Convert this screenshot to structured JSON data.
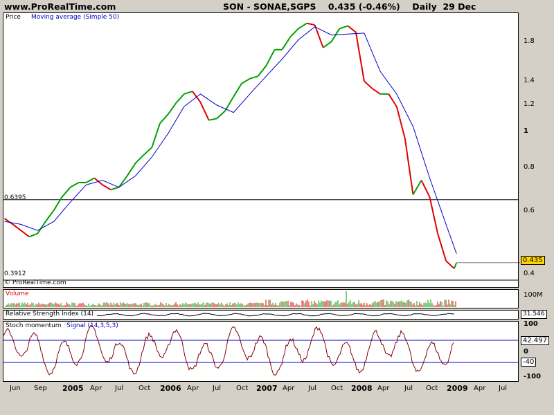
{
  "header": {
    "site": "www.ProRealTime.com",
    "title": "SON - SONAE,SGPS",
    "change": "0.435 (-0.46%)",
    "period": "Daily",
    "date": "29 Dec"
  },
  "price_panel": {
    "price_label": "Price",
    "ma_label": "Moving average (Simple 50)",
    "hline_high": "0.6395",
    "hline_low": "0.3912",
    "credit": "© ProRealTime.com",
    "last_value": "0.435",
    "yticks": [
      "1.8",
      "1.4",
      "1.2",
      "1",
      "0.8",
      "0.6",
      "0.4"
    ]
  },
  "volume_panel": {
    "label": "Volume",
    "ytick": "100M"
  },
  "rsi_panel": {
    "label": "Relative Strength Index (14)",
    "value": "31.546"
  },
  "stoch_panel": {
    "label": "Stoch momentum",
    "signal": "Signal (14,3,5,3)",
    "yticks": [
      "100",
      "0",
      "-100"
    ],
    "value": "42.497",
    "level": "-40"
  },
  "xaxis": {
    "labels": [
      {
        "t": "Jun",
        "bold": false
      },
      {
        "t": "Sep",
        "bold": false
      },
      {
        "t": "2005",
        "bold": true
      },
      {
        "t": "Apr",
        "bold": false
      },
      {
        "t": "Jul",
        "bold": false
      },
      {
        "t": "Oct",
        "bold": false
      },
      {
        "t": "2006",
        "bold": true
      },
      {
        "t": "Apr",
        "bold": false
      },
      {
        "t": "Jul",
        "bold": false
      },
      {
        "t": "Oct",
        "bold": false
      },
      {
        "t": "2007",
        "bold": true
      },
      {
        "t": "Apr",
        "bold": false
      },
      {
        "t": "Jul",
        "bold": false
      },
      {
        "t": "Oct",
        "bold": false
      },
      {
        "t": "2008",
        "bold": true
      },
      {
        "t": "Apr",
        "bold": false
      },
      {
        "t": "Jul",
        "bold": false
      },
      {
        "t": "Oct",
        "bold": false
      },
      {
        "t": "2009",
        "bold": true
      },
      {
        "t": "Apr",
        "bold": false
      },
      {
        "t": "Jul",
        "bold": false
      }
    ]
  },
  "colors": {
    "up": "#00a000",
    "down": "#e00000",
    "ma": "#0000c8",
    "panel_bg": "#ffffff",
    "chrome": "#d4d0c8"
  },
  "chart_data": {
    "type": "line",
    "scale": "log",
    "ylim": [
      0.375,
      2.0
    ],
    "x_range": [
      "2004-05-16",
      "2009-08-15"
    ],
    "series": [
      {
        "name": "Price",
        "points": [
          [
            "2004-05-20",
            0.57
          ],
          [
            "2004-06-20",
            0.55
          ],
          [
            "2004-07-20",
            0.53
          ],
          [
            "2004-08-20",
            0.51
          ],
          [
            "2004-09-20",
            0.52
          ],
          [
            "2004-10-20",
            0.56
          ],
          [
            "2004-11-20",
            0.6
          ],
          [
            "2004-12-20",
            0.65
          ],
          [
            "2005-01-20",
            0.69
          ],
          [
            "2005-02-20",
            0.71
          ],
          [
            "2005-03-20",
            0.71
          ],
          [
            "2005-04-20",
            0.73
          ],
          [
            "2005-05-20",
            0.7
          ],
          [
            "2005-06-20",
            0.68
          ],
          [
            "2005-07-20",
            0.69
          ],
          [
            "2005-08-20",
            0.74
          ],
          [
            "2005-09-20",
            0.8
          ],
          [
            "2005-10-20",
            0.84
          ],
          [
            "2005-11-20",
            0.88
          ],
          [
            "2005-12-20",
            1.02
          ],
          [
            "2006-01-20",
            1.08
          ],
          [
            "2006-02-20",
            1.16
          ],
          [
            "2006-03-20",
            1.22
          ],
          [
            "2006-04-20",
            1.24
          ],
          [
            "2006-05-20",
            1.16
          ],
          [
            "2006-06-20",
            1.04
          ],
          [
            "2006-07-20",
            1.05
          ],
          [
            "2006-08-20",
            1.1
          ],
          [
            "2006-09-20",
            1.2
          ],
          [
            "2006-10-20",
            1.3
          ],
          [
            "2006-11-20",
            1.34
          ],
          [
            "2006-12-20",
            1.36
          ],
          [
            "2007-01-20",
            1.45
          ],
          [
            "2007-02-20",
            1.6
          ],
          [
            "2007-03-20",
            1.6
          ],
          [
            "2007-04-20",
            1.73
          ],
          [
            "2007-05-20",
            1.82
          ],
          [
            "2007-06-20",
            1.88
          ],
          [
            "2007-07-20",
            1.86
          ],
          [
            "2007-08-20",
            1.62
          ],
          [
            "2007-09-20",
            1.68
          ],
          [
            "2007-10-20",
            1.82
          ],
          [
            "2007-11-20",
            1.85
          ],
          [
            "2007-12-20",
            1.78
          ],
          [
            "2008-01-20",
            1.32
          ],
          [
            "2008-02-20",
            1.26
          ],
          [
            "2008-03-20",
            1.22
          ],
          [
            "2008-04-20",
            1.22
          ],
          [
            "2008-05-20",
            1.13
          ],
          [
            "2008-06-20",
            0.93
          ],
          [
            "2008-07-20",
            0.66
          ],
          [
            "2008-08-20",
            0.72
          ],
          [
            "2008-09-20",
            0.65
          ],
          [
            "2008-10-20",
            0.52
          ],
          [
            "2008-11-20",
            0.44
          ],
          [
            "2008-12-20",
            0.42
          ],
          [
            "2008-12-29",
            0.435
          ]
        ]
      },
      {
        "name": "Moving average (Simple 50)",
        "points": [
          [
            "2004-05-20",
            0.56
          ],
          [
            "2004-07-20",
            0.55
          ],
          [
            "2004-09-20",
            0.53
          ],
          [
            "2004-11-20",
            0.56
          ],
          [
            "2005-01-20",
            0.63
          ],
          [
            "2005-03-20",
            0.7
          ],
          [
            "2005-05-20",
            0.72
          ],
          [
            "2005-07-20",
            0.69
          ],
          [
            "2005-09-20",
            0.74
          ],
          [
            "2005-11-20",
            0.83
          ],
          [
            "2006-01-20",
            0.96
          ],
          [
            "2006-03-20",
            1.13
          ],
          [
            "2006-05-20",
            1.22
          ],
          [
            "2006-07-20",
            1.14
          ],
          [
            "2006-09-20",
            1.09
          ],
          [
            "2006-11-20",
            1.22
          ],
          [
            "2007-01-20",
            1.36
          ],
          [
            "2007-03-20",
            1.51
          ],
          [
            "2007-05-20",
            1.7
          ],
          [
            "2007-07-20",
            1.84
          ],
          [
            "2007-09-20",
            1.75
          ],
          [
            "2007-11-20",
            1.76
          ],
          [
            "2008-01-20",
            1.77
          ],
          [
            "2008-03-20",
            1.4
          ],
          [
            "2008-05-20",
            1.22
          ],
          [
            "2008-07-20",
            1.0
          ],
          [
            "2008-09-20",
            0.73
          ],
          [
            "2008-11-20",
            0.55
          ],
          [
            "2008-12-29",
            0.46
          ]
        ]
      }
    ]
  }
}
